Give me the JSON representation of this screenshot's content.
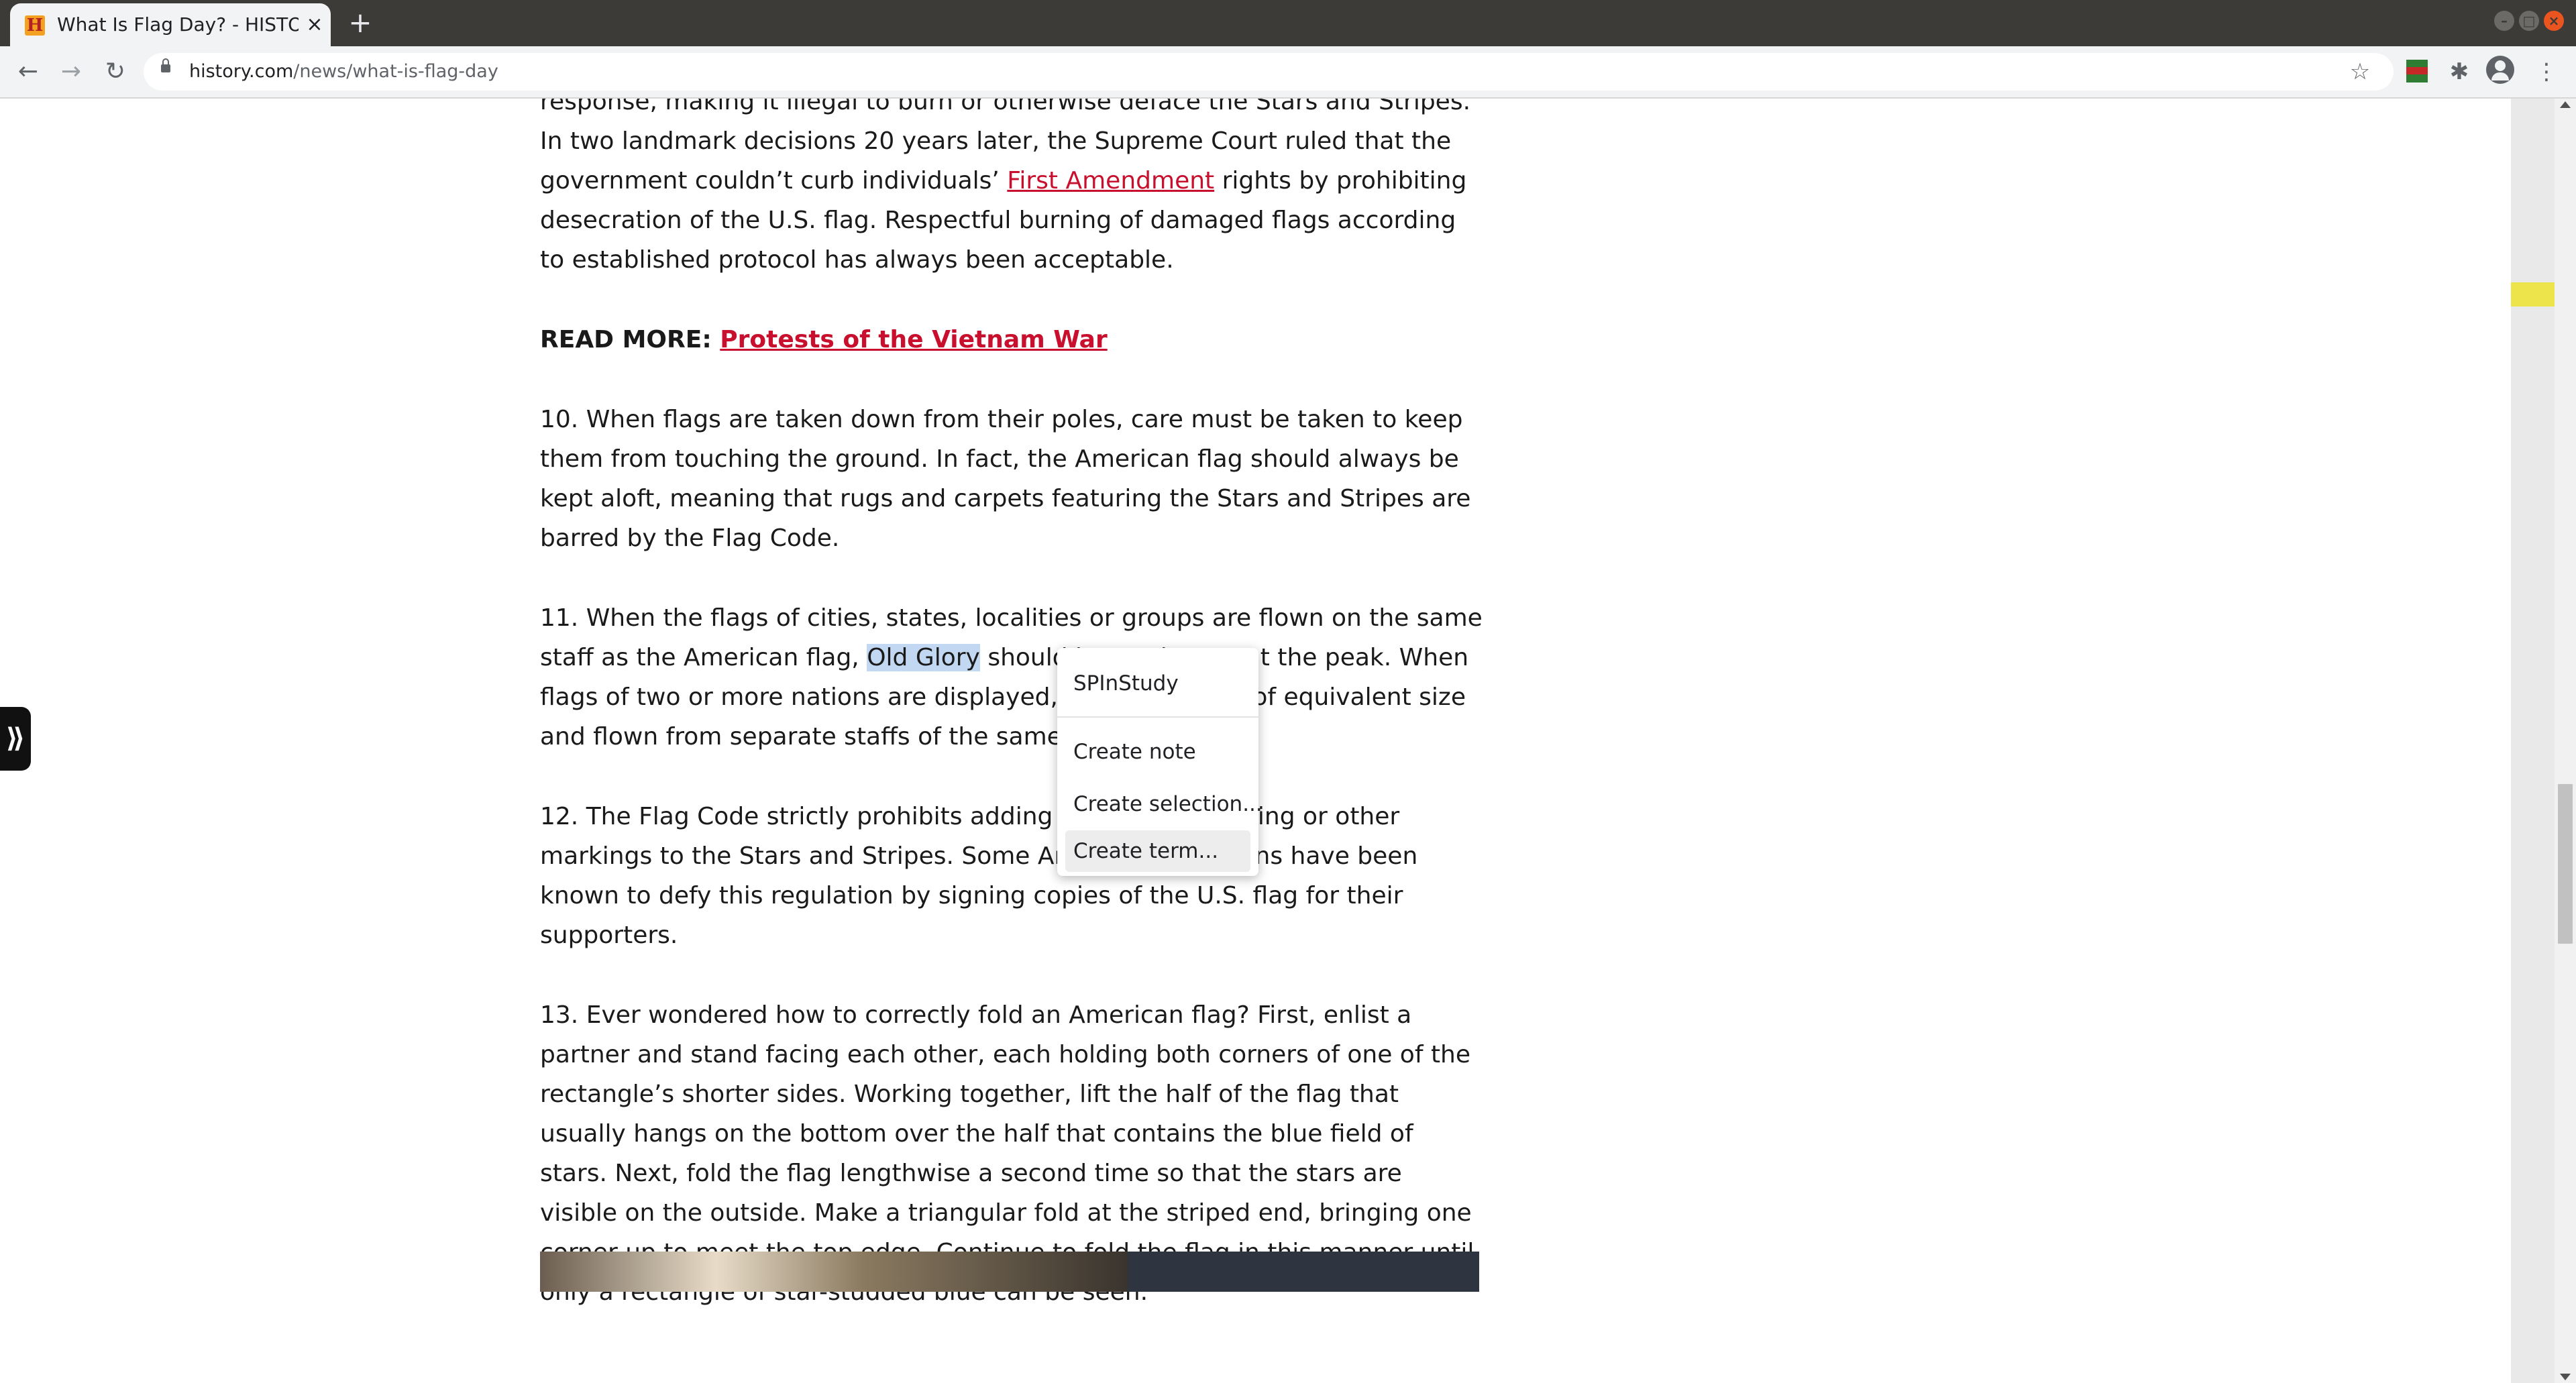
{
  "browser": {
    "tab_title": "What Is Flag Day? - HISTORY",
    "tab_favicon": "H",
    "new_tab_label": "+",
    "url_domain": "history.com",
    "url_path": "/news/what-is-flag-day"
  },
  "icons": {
    "back": "back-arrow-icon",
    "forward": "forward-arrow-icon",
    "reload": "reload-icon",
    "star": "star-icon",
    "extension": "puzzle-icon",
    "menu": "kebab-menu-icon"
  },
  "article": {
    "p1": "response, making it illegal to burn or otherwise deface the Stars and Stripes. In two landmark decisions 20 years later, the Supreme Court ruled that the government couldn’t curb individuals’ ",
    "p1_link": "First Amendment",
    "p1_tail": " rights by prohibiting desecration of the U.S. flag. Respectful burning of damaged flags according to established protocol has always been acceptable.",
    "readmore_label": "READ MORE: ",
    "readmore_link": "Protests of the Vietnam War ",
    "p10": "10. When flags are taken down from their poles, care must be taken to keep them from touching the ground. In fact, the American flag should always be kept aloft, meaning that rugs and carpets featuring the Stars and Stripes are barred by the Flag Code.",
    "p11_a": "11. When the flags of cities, states, localities or groups are flown on the same staff as the American flag, ",
    "p11_sel": "Old Glory",
    "p11_b": " should be on the top at the peak. When flags of two or more nations are displayed, they should be of equivalent size and flown from separate staffs of the same height.",
    "p12": "12. The Flag Code strictly prohibits adding any sort of drawing or other markings to the Stars and Stripes. Some American politicians have been known to defy this regulation by signing copies of the U.S. flag for their supporters.",
    "p13": "13. Ever wondered how to correctly fold an American flag? First, enlist a partner and stand facing each other, each holding both corners of one of the rectangle’s shorter sides. Working together, lift the half of the flag that usually hangs on the bottom over the half that contains the blue field of stars. Next, fold the flag lengthwise a second time so that the stars are visible on the outside. Make a triangular fold at the striped end, bringing one corner up to meet the top edge. Continue to fold the flag in this manner until only a rectangle of star-studded blue can be seen."
  },
  "context_menu": {
    "header": "SPInStudy",
    "items": [
      "Create note",
      "Create selection...",
      "Create term..."
    ]
  },
  "colors": {
    "link": "#c8102e",
    "selection": "#c2d8f2",
    "annotation_mark": "#ede34b"
  }
}
